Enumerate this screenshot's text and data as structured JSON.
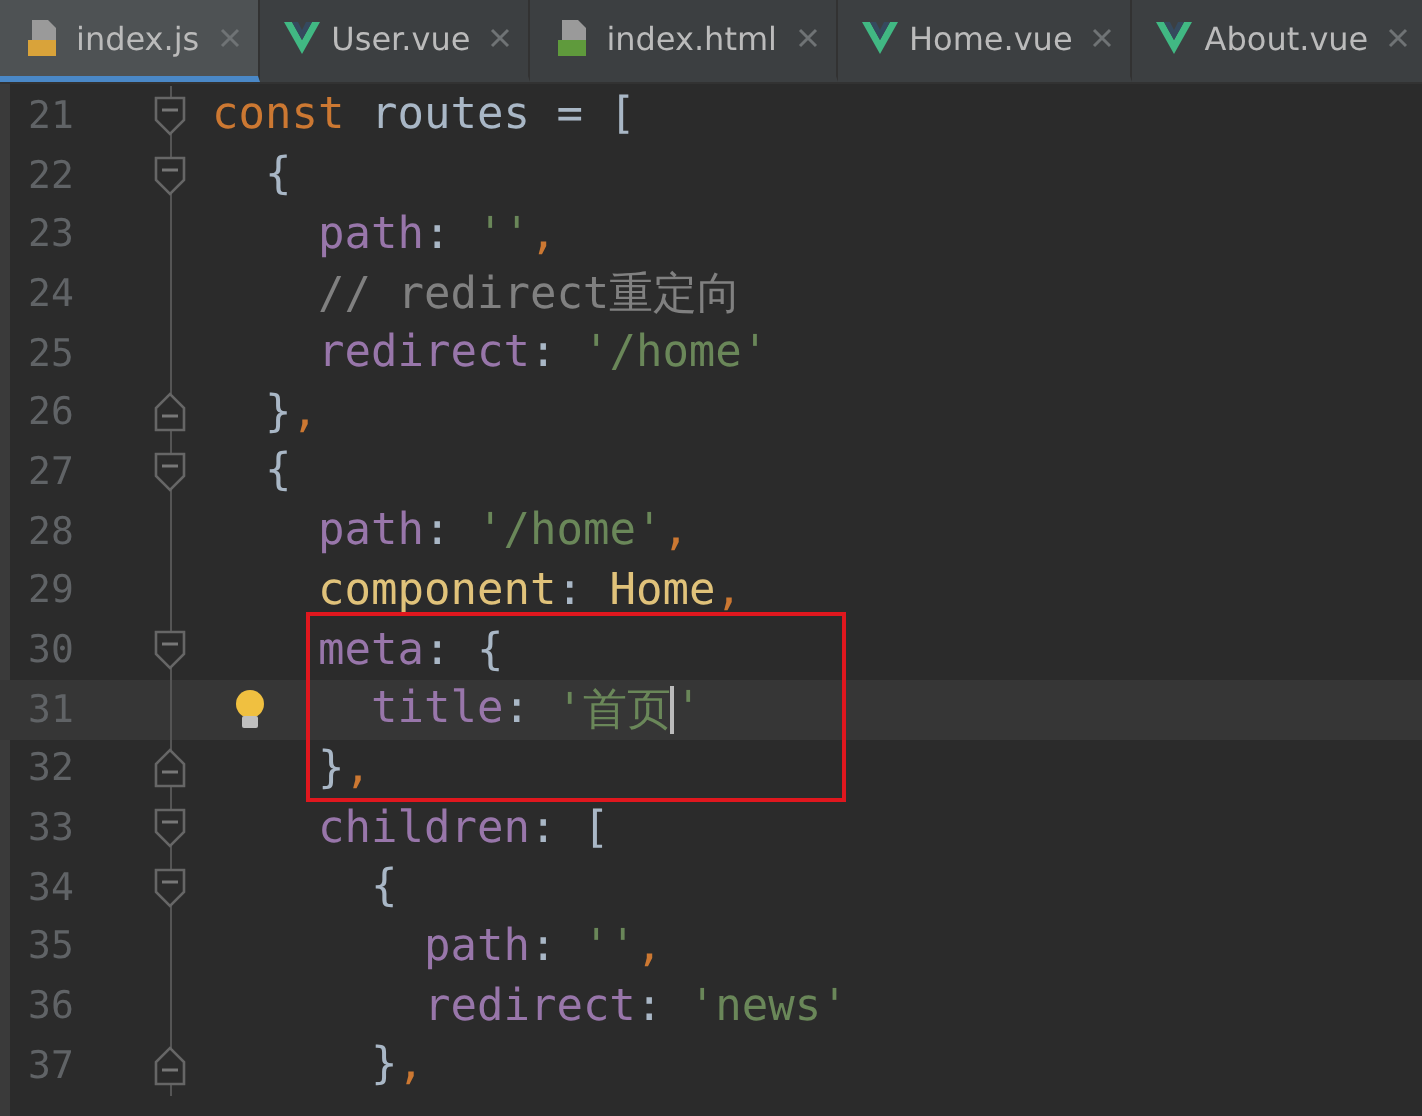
{
  "tabs": [
    {
      "label": "index.js",
      "kind": "js",
      "selected": true
    },
    {
      "label": "User.vue",
      "kind": "vue",
      "selected": false
    },
    {
      "label": "index.html",
      "kind": "html",
      "selected": false
    },
    {
      "label": "Home.vue",
      "kind": "vue",
      "selected": false
    },
    {
      "label": "About.vue",
      "kind": "vue",
      "selected": false
    }
  ],
  "lines": [
    {
      "number": "21",
      "fold_start": true,
      "fold_end": false,
      "current": false,
      "boxed": false,
      "bulb": false,
      "tokens": [
        {
          "t": "const",
          "kind": "keyword"
        },
        {
          "t": " routes = [",
          "kind": "plain"
        }
      ]
    },
    {
      "number": "22",
      "fold_start": true,
      "fold_end": false,
      "current": false,
      "boxed": false,
      "bulb": false,
      "tokens": [
        {
          "t": "  {",
          "kind": "plain"
        }
      ]
    },
    {
      "number": "23",
      "fold_start": false,
      "fold_end": false,
      "current": false,
      "boxed": false,
      "bulb": false,
      "tokens": [
        {
          "t": "    path",
          "kind": "prop"
        },
        {
          "t": ": ",
          "kind": "plain"
        },
        {
          "t": "''",
          "kind": "string"
        },
        {
          "t": ",",
          "kind": "keyword"
        }
      ]
    },
    {
      "number": "24",
      "fold_start": false,
      "fold_end": false,
      "current": false,
      "boxed": false,
      "bulb": false,
      "tokens": [
        {
          "t": "    // redirect重定向",
          "kind": "comment"
        }
      ]
    },
    {
      "number": "25",
      "fold_start": false,
      "fold_end": false,
      "current": false,
      "boxed": false,
      "bulb": false,
      "tokens": [
        {
          "t": "    redirect",
          "kind": "prop"
        },
        {
          "t": ": ",
          "kind": "plain"
        },
        {
          "t": "'/home'",
          "kind": "string"
        }
      ]
    },
    {
      "number": "26",
      "fold_start": false,
      "fold_end": true,
      "current": false,
      "boxed": false,
      "bulb": false,
      "tokens": [
        {
          "t": "  }",
          "kind": "plain"
        },
        {
          "t": ",",
          "kind": "keyword"
        }
      ]
    },
    {
      "number": "27",
      "fold_start": true,
      "fold_end": false,
      "current": false,
      "boxed": false,
      "bulb": false,
      "tokens": [
        {
          "t": "  {",
          "kind": "plain"
        }
      ]
    },
    {
      "number": "28",
      "fold_start": false,
      "fold_end": false,
      "current": false,
      "boxed": false,
      "bulb": false,
      "tokens": [
        {
          "t": "    path",
          "kind": "prop"
        },
        {
          "t": ": ",
          "kind": "plain"
        },
        {
          "t": "'/home'",
          "kind": "string"
        },
        {
          "t": ",",
          "kind": "keyword"
        }
      ]
    },
    {
      "number": "29",
      "fold_start": false,
      "fold_end": false,
      "current": false,
      "boxed": false,
      "bulb": false,
      "tokens": [
        {
          "t": "    component",
          "kind": "name"
        },
        {
          "t": ": ",
          "kind": "plain"
        },
        {
          "t": "Home",
          "kind": "name"
        },
        {
          "t": ",",
          "kind": "keyword"
        }
      ]
    },
    {
      "number": "30",
      "fold_start": true,
      "fold_end": false,
      "current": false,
      "boxed": true,
      "bulb": false,
      "tokens": [
        {
          "t": "    meta",
          "kind": "prop"
        },
        {
          "t": ": {",
          "kind": "plain"
        }
      ]
    },
    {
      "number": "31",
      "fold_start": false,
      "fold_end": false,
      "current": true,
      "boxed": true,
      "bulb": true,
      "tokens": [
        {
          "t": "      title",
          "kind": "prop"
        },
        {
          "t": ": ",
          "kind": "plain"
        },
        {
          "t": "'首页",
          "kind": "string",
          "caret": true
        },
        {
          "t": "'",
          "kind": "string"
        }
      ]
    },
    {
      "number": "32",
      "fold_start": false,
      "fold_end": true,
      "current": false,
      "boxed": true,
      "bulb": false,
      "tokens": [
        {
          "t": "    }",
          "kind": "plain"
        },
        {
          "t": ",",
          "kind": "keyword"
        }
      ]
    },
    {
      "number": "33",
      "fold_start": true,
      "fold_end": false,
      "current": false,
      "boxed": false,
      "bulb": false,
      "tokens": [
        {
          "t": "    children",
          "kind": "prop"
        },
        {
          "t": ": [",
          "kind": "plain"
        }
      ]
    },
    {
      "number": "34",
      "fold_start": true,
      "fold_end": false,
      "current": false,
      "boxed": false,
      "bulb": false,
      "tokens": [
        {
          "t": "      {",
          "kind": "plain"
        }
      ]
    },
    {
      "number": "35",
      "fold_start": false,
      "fold_end": false,
      "current": false,
      "boxed": false,
      "bulb": false,
      "tokens": [
        {
          "t": "        path",
          "kind": "prop"
        },
        {
          "t": ": ",
          "kind": "plain"
        },
        {
          "t": "''",
          "kind": "string"
        },
        {
          "t": ",",
          "kind": "keyword"
        }
      ]
    },
    {
      "number": "36",
      "fold_start": false,
      "fold_end": false,
      "current": false,
      "boxed": false,
      "bulb": false,
      "tokens": [
        {
          "t": "        redirect",
          "kind": "prop"
        },
        {
          "t": ": ",
          "kind": "plain"
        },
        {
          "t": "'news'",
          "kind": "string"
        }
      ]
    },
    {
      "number": "37",
      "fold_start": false,
      "fold_end": true,
      "current": false,
      "boxed": false,
      "bulb": false,
      "tokens": [
        {
          "t": "      }",
          "kind": "plain"
        },
        {
          "t": ",",
          "kind": "keyword"
        }
      ]
    }
  ]
}
